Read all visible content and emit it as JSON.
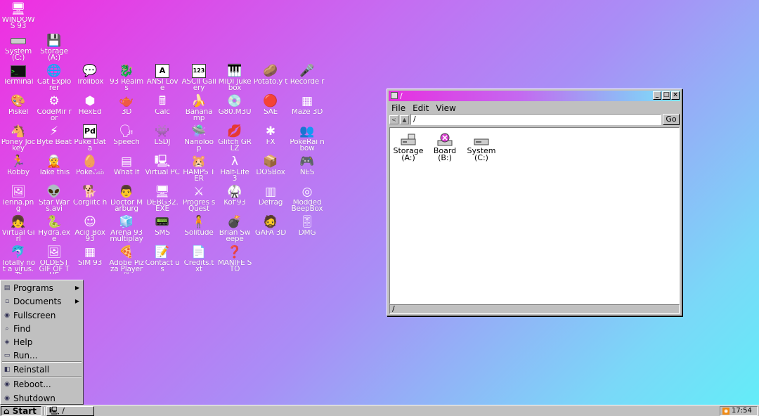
{
  "desktop": {
    "icons": [
      {
        "label": "WINDOWS 93",
        "glyph": "🖥",
        "icon": "computer-icon"
      },
      {
        "label": "System (C:)",
        "glyph": "drive",
        "icon": "drive-icon"
      },
      {
        "label": "Storage (A:)",
        "glyph": "💾",
        "icon": "storage-drive-icon"
      },
      {
        "label": "Terminal",
        "glyph": "term",
        "icon": "terminal-icon"
      },
      {
        "label": "Cat Explorer",
        "glyph": "🌐",
        "icon": "globe-icon"
      },
      {
        "label": "Trollbox",
        "glyph": "💬",
        "icon": "chat-icon"
      },
      {
        "label": "93 Realms",
        "glyph": "🐉",
        "icon": "dragon-icon"
      },
      {
        "label": "ANSI Love",
        "glyph": "A",
        "icon": "ansi-icon"
      },
      {
        "label": "ASCII Gallery",
        "glyph": "123",
        "icon": "ascii-icon"
      },
      {
        "label": "MIDI Jukebox",
        "glyph": "🎹",
        "icon": "piano-icon"
      },
      {
        "label": "Potato.y t",
        "glyph": "🥔",
        "icon": "potato-icon"
      },
      {
        "label": "Recorde r",
        "glyph": "🎤",
        "icon": "microphone-icon"
      },
      {
        "label": "Piskel",
        "glyph": "🎨",
        "icon": "palette-icon"
      },
      {
        "label": "CodeMir ror",
        "glyph": "⚙",
        "icon": "codemirror-icon"
      },
      {
        "label": "HexEd",
        "glyph": "⬢",
        "icon": "hex-icon"
      },
      {
        "label": "3D",
        "glyph": "🫖",
        "icon": "teapot-icon"
      },
      {
        "label": "Calc",
        "glyph": "🖩",
        "icon": "calculator-icon"
      },
      {
        "label": "Banana mp",
        "glyph": "🍌",
        "icon": "banana-icon"
      },
      {
        "label": "G80.M3U",
        "glyph": "💿",
        "icon": "playlist-icon"
      },
      {
        "label": "SAE",
        "glyph": "🔴",
        "icon": "sae-icon"
      },
      {
        "label": "Maze 3D",
        "glyph": "▦",
        "icon": "maze-icon"
      },
      {
        "label": "Poney Jockey",
        "glyph": "🐴",
        "icon": "pony-icon"
      },
      {
        "label": "Byte Beat",
        "glyph": "⚡",
        "icon": "bytebeat-icon"
      },
      {
        "label": "Puke Data",
        "glyph": "Pd",
        "icon": "pd-icon"
      },
      {
        "label": "Speech",
        "glyph": "🗣",
        "icon": "speech-icon"
      },
      {
        "label": "LSDJ",
        "glyph": "👾",
        "icon": "lsdj-icon"
      },
      {
        "label": "Nanoloo p",
        "glyph": "🛸",
        "icon": "nanoloop-icon"
      },
      {
        "label": "Glitch GRLZ",
        "glyph": "💋",
        "icon": "lips-icon"
      },
      {
        "label": "FX",
        "glyph": "✱",
        "icon": "fx-icon"
      },
      {
        "label": "PokéRai nbow",
        "glyph": "👥",
        "icon": "pokerainbow-icon"
      },
      {
        "label": "Robby",
        "glyph": "🏃",
        "icon": "robby-icon"
      },
      {
        "label": "Take this",
        "glyph": "🧝",
        "icon": "take-this-icon"
      },
      {
        "label": "Pokeஃம்",
        "glyph": "🥚",
        "icon": "poke-icon"
      },
      {
        "label": "What If",
        "glyph": "▤",
        "icon": "what-if-icon"
      },
      {
        "label": "Virtual PC",
        "glyph": "🖳",
        "icon": "virtual-pc-icon"
      },
      {
        "label": "HAMPS TER",
        "glyph": "🐹",
        "icon": "hamster-icon"
      },
      {
        "label": "Half-Life 3",
        "glyph": "λ",
        "icon": "half-life-icon"
      },
      {
        "label": "DOSBox",
        "glyph": "📦",
        "icon": "dosbox-icon"
      },
      {
        "label": "NES",
        "glyph": "🎮",
        "icon": "nes-icon"
      },
      {
        "label": "lenna.pn g",
        "glyph": "🖼",
        "icon": "image-file-icon"
      },
      {
        "label": "Star Wars.avi",
        "glyph": "👽",
        "icon": "star-wars-icon"
      },
      {
        "label": "Corglitc h",
        "glyph": "🐕",
        "icon": "corgi-icon"
      },
      {
        "label": "Doctor Marburg",
        "glyph": "👨",
        "icon": "doctor-icon"
      },
      {
        "label": "DEBG32. EXE",
        "glyph": "🖥",
        "icon": "debug-icon"
      },
      {
        "label": "Progres s Quest",
        "glyph": "⚔",
        "icon": "progress-quest-icon"
      },
      {
        "label": "Kof'93",
        "glyph": "🥋",
        "icon": "kof-icon"
      },
      {
        "label": "Defrag",
        "glyph": "▥",
        "icon": "defrag-icon"
      },
      {
        "label": "Modded BeepBox",
        "glyph": "◎",
        "icon": "beepbox-icon"
      },
      {
        "label": "Virtual Girl",
        "glyph": "👧",
        "icon": "virtual-girl-icon"
      },
      {
        "label": "Hydra.ex e",
        "glyph": "🐍",
        "icon": "hydra-icon"
      },
      {
        "label": "Acid Box 93",
        "glyph": "☺",
        "icon": "smiley-icon"
      },
      {
        "label": "Arena 93 multiplay",
        "glyph": "🧊",
        "icon": "arena-icon"
      },
      {
        "label": "SMS",
        "glyph": "📟",
        "icon": "sms-icon"
      },
      {
        "label": "Solitude",
        "glyph": "🧍",
        "icon": "solitude-icon"
      },
      {
        "label": "Brian Sweepe",
        "glyph": "💣",
        "icon": "mine-icon"
      },
      {
        "label": "GAFA 3D",
        "glyph": "🧔",
        "icon": "gafa-icon"
      },
      {
        "label": "DMG",
        "glyph": "🎚",
        "icon": "dmg-icon"
      },
      {
        "label": "Totally not a virus.Tr",
        "glyph": "🐬",
        "icon": "dolphin-icon"
      },
      {
        "label": "OLDEST GIF OF THE",
        "glyph": "🖼",
        "icon": "gif-file-icon"
      },
      {
        "label": "SIM 93",
        "glyph": "▦",
        "icon": "sim-icon"
      },
      {
        "label": "Adobe Pizza Player™",
        "glyph": "🍕",
        "icon": "pizza-icon"
      },
      {
        "label": "Contact us",
        "glyph": "📝",
        "icon": "contact-icon"
      },
      {
        "label": "Credits.t xt",
        "glyph": "📄",
        "icon": "text-file-icon"
      },
      {
        "label": "MANIFE STO",
        "glyph": "❓",
        "icon": "question-icon"
      }
    ]
  },
  "window": {
    "title": "/",
    "menu": [
      "File",
      "Edit",
      "View"
    ],
    "back_label": "<",
    "up_label": "▲",
    "address": "/",
    "go_label": "Go",
    "items": [
      {
        "label": "Storage (A:)",
        "icon": "storage-drive-icon"
      },
      {
        "label": "Board (B:)",
        "icon": "board-drive-icon"
      },
      {
        "label": "System (C:)",
        "icon": "system-drive-icon"
      }
    ],
    "status": "/"
  },
  "startmenu": {
    "items": [
      {
        "label": "Programs",
        "icon": "programs-icon",
        "submenu": true
      },
      {
        "label": "Documents",
        "icon": "documents-icon",
        "submenu": true
      },
      {
        "label": "Fullscreen",
        "icon": "fullscreen-icon"
      },
      {
        "label": "Find",
        "icon": "find-icon"
      },
      {
        "label": "Help",
        "icon": "help-icon"
      },
      {
        "label": "Run...",
        "icon": "run-icon"
      },
      {
        "label": "Reinstall",
        "icon": "reinstall-icon"
      },
      {
        "label": "Reboot...",
        "icon": "reboot-icon"
      },
      {
        "label": "Shutdown",
        "icon": "shutdown-icon"
      }
    ]
  },
  "taskbar": {
    "start_label": "Start",
    "task_label": "/",
    "clock": "17:54"
  }
}
